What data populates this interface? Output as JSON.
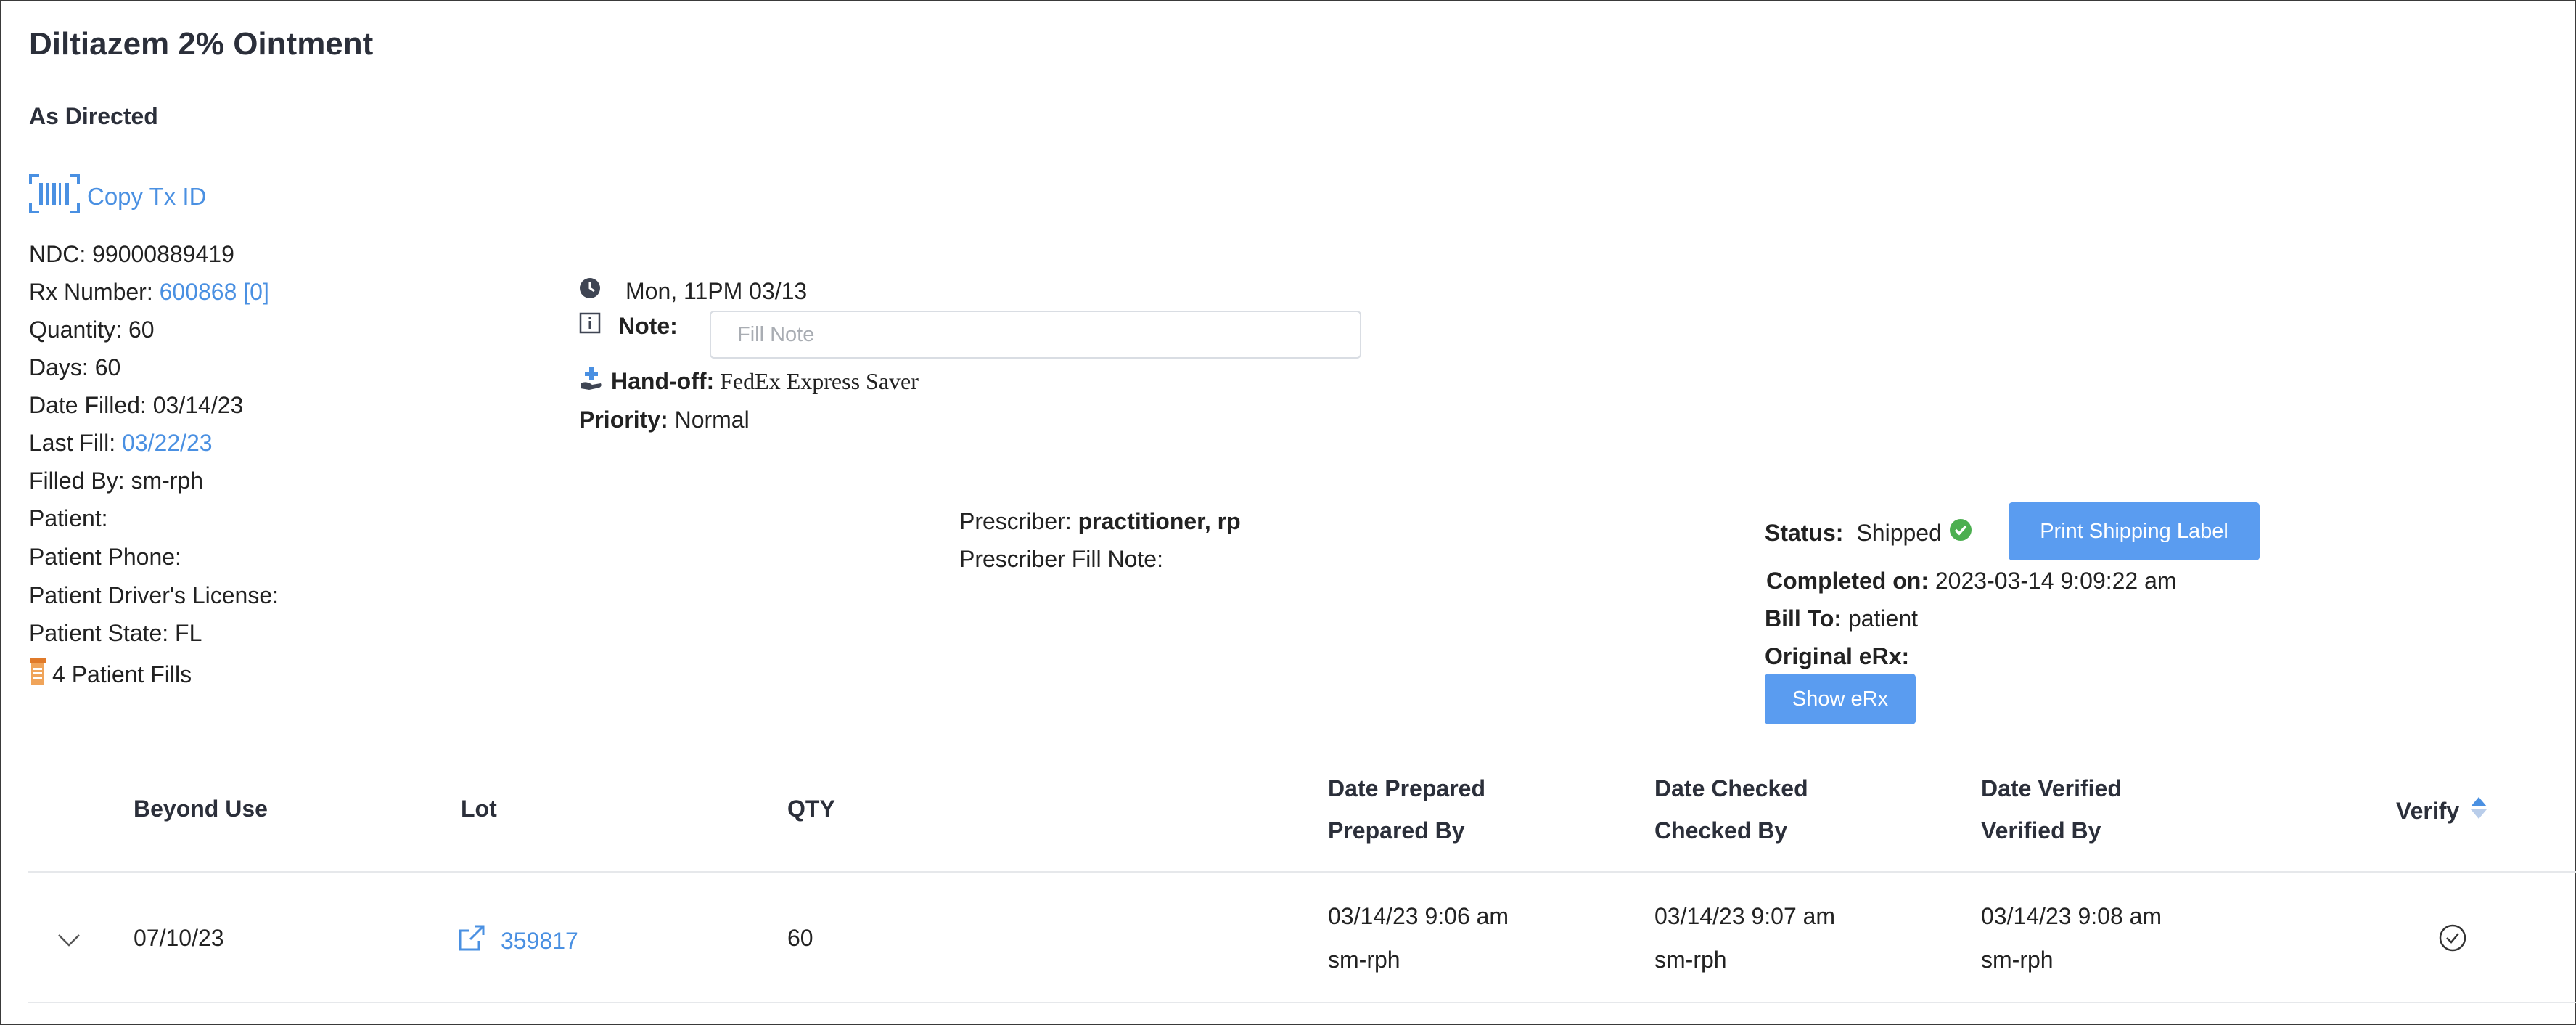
{
  "header": {
    "title": "Diltiazem 2% Ointment",
    "directions": "As Directed",
    "copy_tx_label": "Copy Tx ID"
  },
  "details": {
    "ndc_label": "NDC:",
    "ndc": "99000889419",
    "rx_label": "Rx Number:",
    "rx_number": "600868 [0]",
    "quantity_label": "Quantity:",
    "quantity": "60",
    "days_label": "Days:",
    "days": "60",
    "date_filled_label": "Date Filled:",
    "date_filled": "03/14/23",
    "last_fill_label": "Last Fill:",
    "last_fill": "03/22/23",
    "filled_by_label": "Filled By:",
    "filled_by": "sm-rph",
    "patient_label": "Patient:",
    "patient_phone_label": "Patient Phone:",
    "patient_license_label": "Patient Driver's License:",
    "patient_state_label": "Patient State:",
    "patient_state": "FL",
    "patient_fills": "4 Patient Fills"
  },
  "order": {
    "datetime": "Mon, 11PM 03/13",
    "note_label": "Note:",
    "note_placeholder": "Fill Note",
    "handoff_label": "Hand-off:",
    "handoff_value": "FedEx Express Saver",
    "priority_label": "Priority:",
    "priority_value": "Normal"
  },
  "prescriber": {
    "label": "Prescriber:",
    "name": "practitioner, rp",
    "fill_note_label": "Prescriber Fill Note:"
  },
  "status": {
    "label": "Status:",
    "value": "Shipped",
    "print_label": "Print Shipping Label",
    "completed_label": "Completed on:",
    "completed_value": "2023-03-14 9:09:22 am",
    "bill_to_label": "Bill To:",
    "bill_to_value": "patient",
    "original_erx_label": "Original eRx:",
    "show_erx_label": "Show eRx"
  },
  "table": {
    "headers": {
      "beyond_use": "Beyond Use",
      "lot": "Lot",
      "qty": "QTY",
      "date_prepared": "Date Prepared",
      "prepared_by": "Prepared By",
      "date_checked": "Date Checked",
      "checked_by": "Checked By",
      "date_verified": "Date Verified",
      "verified_by": "Verified By",
      "verify": "Verify"
    },
    "rows": [
      {
        "beyond_use": "07/10/23",
        "lot": "359817",
        "qty": "60",
        "date_prepared": "03/14/23 9:06 am",
        "prepared_by": "sm-rph",
        "date_checked": "03/14/23 9:07 am",
        "checked_by": "sm-rph",
        "date_verified": "03/14/23 9:08 am",
        "verified_by": "sm-rph"
      }
    ]
  },
  "colors": {
    "link": "#4a90e2",
    "button": "#5a9cf0",
    "success": "#4caf50",
    "heading": "#2b2f3a"
  },
  "icons": [
    "barcode-icon",
    "clock-icon",
    "info-icon",
    "handoff-icon",
    "check-circle-icon",
    "pill-bottle-icon",
    "sort-icon",
    "external-link-icon",
    "chevron-down-icon",
    "verify-check-icon"
  ]
}
